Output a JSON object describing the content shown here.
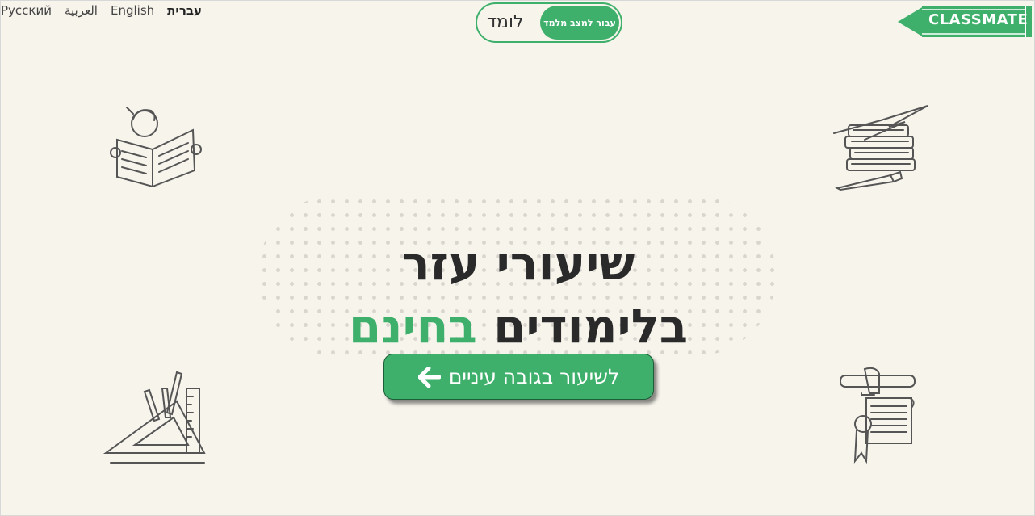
{
  "languages": [
    {
      "label": "Русский",
      "active": false
    },
    {
      "label": "العربية",
      "active": false
    },
    {
      "label": "English",
      "active": false
    },
    {
      "label": "עברית",
      "active": true
    }
  ],
  "mode_toggle": {
    "active_label": "עבור למצב מלמד",
    "inactive_label": "לומד"
  },
  "logo": {
    "text": "CLASSMATE"
  },
  "headline": {
    "line1": "שיעורי עזר",
    "line2_prefix": "בלימודים",
    "line2_highlight": "בחינם"
  },
  "cta": {
    "label": "לשיעור בגובה עיניים",
    "icon": "arrow-left-icon"
  },
  "illustrations": [
    "reading-student-icon",
    "books-pencil-icon",
    "ruler-triangle-icon",
    "scroll-hand-icon"
  ],
  "colors": {
    "accent": "#3fb06b",
    "background": "#f7f4ec",
    "text": "#2a2a2a"
  }
}
